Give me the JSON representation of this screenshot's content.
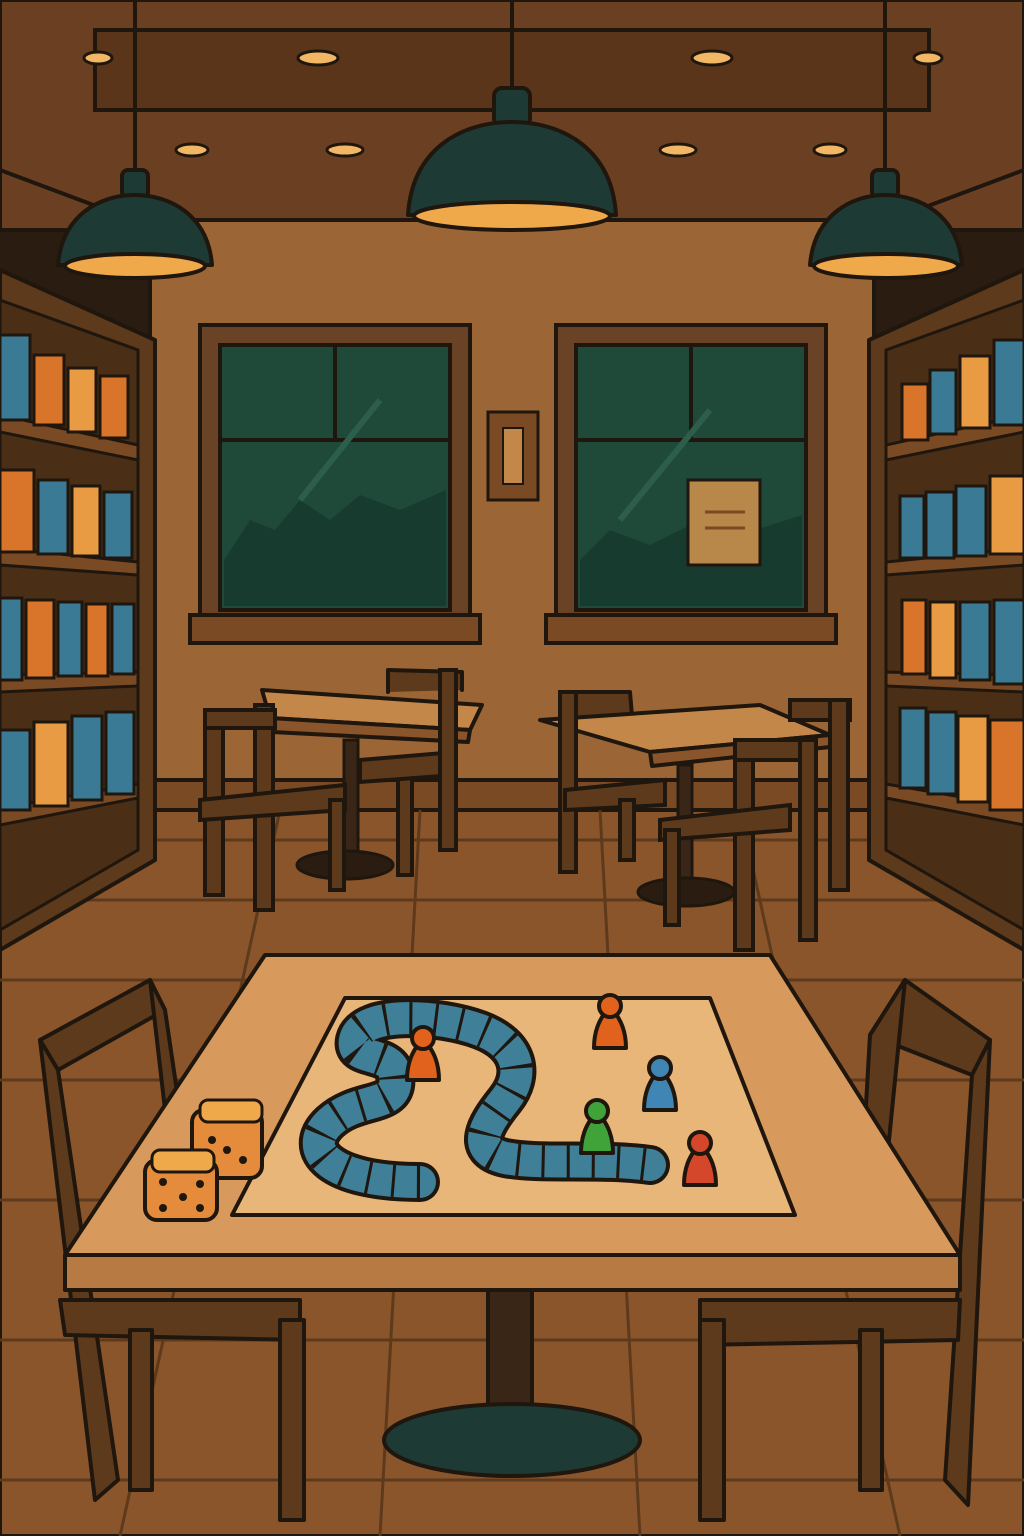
{
  "scene": {
    "description_free": true,
    "palette": {
      "wall": "#9c6535",
      "wall_dark": "#7a4a24",
      "ceiling": "#6b4022",
      "floor": "#8a552b",
      "wood": "#6a4327",
      "table_top": "#d89a5c",
      "board": "#e9b67a",
      "path": "#3f7f98",
      "window_glass": "#1f4a3a",
      "lamp": "#1e3a34",
      "lamp_glow": "#f0a94a",
      "outline": "#1f160e",
      "book_blue": "#3a7a94",
      "book_orange": "#d9752a",
      "book_amber": "#e89b42"
    },
    "pawns": [
      {
        "name": "orange-pawn-top",
        "color": "#e0621d"
      },
      {
        "name": "orange-pawn-left",
        "color": "#e0621d"
      },
      {
        "name": "blue-pawn",
        "color": "#3f86b4"
      },
      {
        "name": "green-pawn",
        "color": "#3fa33a"
      },
      {
        "name": "red-pawn",
        "color": "#d5472a"
      }
    ],
    "dice": [
      {
        "name": "die-back",
        "pips": 3
      },
      {
        "name": "die-front",
        "pips": 5
      }
    ]
  }
}
